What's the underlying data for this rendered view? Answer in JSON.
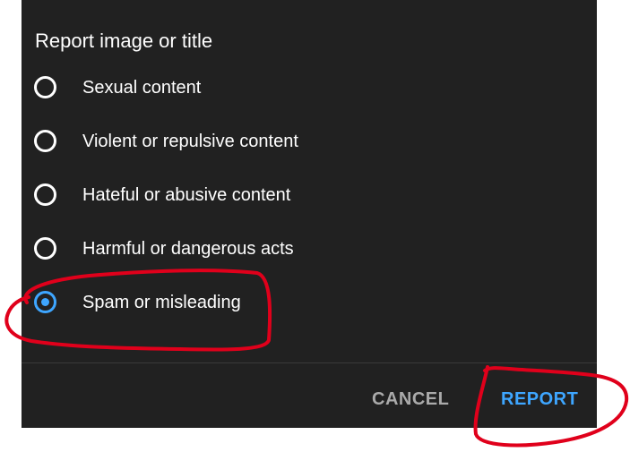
{
  "dialog": {
    "title": "Report image or title",
    "options": [
      {
        "label": "Sexual content",
        "selected": false
      },
      {
        "label": "Violent or repulsive content",
        "selected": false
      },
      {
        "label": "Hateful or abusive content",
        "selected": false
      },
      {
        "label": "Harmful or dangerous acts",
        "selected": false
      },
      {
        "label": "Spam or misleading",
        "selected": true
      }
    ],
    "cancel_label": "CANCEL",
    "report_label": "REPORT"
  },
  "colors": {
    "dialog_background": "#212121",
    "accent": "#3ea6ff",
    "text": "#ffffff",
    "cancel_text": "#aaaaaa",
    "annotation": "#e0001b"
  }
}
